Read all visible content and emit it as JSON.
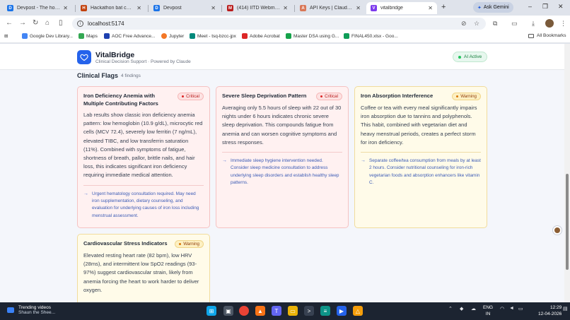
{
  "browser": {
    "tabs": [
      {
        "label": "Devpost - The home fo",
        "favicon": "D",
        "color": "#1a73e8"
      },
      {
        "label": "Hackathon bat challeng",
        "favicon": "H",
        "color": "#c2410c"
      },
      {
        "label": "Devpost",
        "favicon": "D",
        "color": "#1a73e8"
      },
      {
        "label": "(414) IITD Webmail :: In",
        "favicon": "M",
        "color": "#b91c1c"
      },
      {
        "label": "API Keys | Claude Platfo",
        "favicon": "A",
        "color": "#d97757"
      },
      {
        "label": "vitalbridge",
        "favicon": "V",
        "color": "#7c3aed"
      }
    ],
    "new_tab": "+",
    "gemini": "Ask Gemini",
    "window_controls": [
      "–",
      "❐",
      "✕"
    ],
    "address": "localhost:5174",
    "bookmarks": [
      {
        "label": "Google Dev Library...",
        "color": "#4285f4"
      },
      {
        "label": "Maps",
        "color": "#34a853"
      },
      {
        "label": "AOC Free Advance...",
        "color": "#1e40af"
      },
      {
        "label": "Jupyter",
        "color": "#f37726"
      },
      {
        "label": "Meet - tsq-bzcc-jpx",
        "color": "#00897b"
      },
      {
        "label": "Adobe Acrobat",
        "color": "#dc2626"
      },
      {
        "label": "Master DSA using G...",
        "color": "#16a34a"
      },
      {
        "label": "FINAL450.xlsx - Goo...",
        "color": "#0f9d58"
      }
    ],
    "all_bookmarks": "All Bookmarks"
  },
  "app": {
    "brand": "VitalBridge",
    "subtitle": "Clinical Decision Support · Powered by Claude",
    "status": "AI Active"
  },
  "flags": {
    "title": "Clinical Flags",
    "count": "4 findings",
    "cards": [
      {
        "title": "Iron Deficiency Anemia with Multiple Contributing Factors",
        "severity": "Critical",
        "body": "Lab results show classic iron deficiency anemia pattern: low hemoglobin (10.9 g/dL), microcytic red cells (MCV 72.4), severely low ferritin (7 ng/mL), elevated TIBC, and low transferrin saturation (11%). Combined with symptoms of fatigue, shortness of breath, pallor, brittle nails, and hair loss, this indicates significant iron deficiency requiring immediate medical attention.",
        "recommendation": "Urgent hematology consultation required. May need iron supplementation, dietary counseling, and evaluation for underlying causes of iron loss including menstrual assessment."
      },
      {
        "title": "Severe Sleep Deprivation Pattern",
        "severity": "Critical",
        "body": "Averaging only 5.5 hours of sleep with 22 out of 30 nights under 6 hours indicates chronic severe sleep deprivation. This compounds fatigue from anemia and can worsen cognitive symptoms and stress responses.",
        "recommendation": "Immediate sleep hygiene intervention needed. Consider sleep medicine consultation to address underlying sleep disorders and establish healthy sleep patterns."
      },
      {
        "title": "Iron Absorption Interference",
        "severity": "Warning",
        "body": "Coffee or tea with every meal significantly impairs iron absorption due to tannins and polyphenols. This habit, combined with vegetarian diet and heavy menstrual periods, creates a perfect storm for iron deficiency.",
        "recommendation": "Separate coffee/tea consumption from meals by at least 2 hours. Consider nutritional counseling for iron-rich vegetarian foods and absorption enhancers like vitamin C."
      },
      {
        "title": "Cardiovascular Stress Indicators",
        "severity": "Warning",
        "body": "Elevated resting heart rate (82 bpm), low HRV (28ms), and intermittent low SpO2 readings (93-97%) suggest cardiovascular strain, likely from anemia forcing the heart to work harder to deliver oxygen.",
        "recommendation": ""
      }
    ]
  },
  "taskbar": {
    "news_title": "Trending videos",
    "news_sub": "Shaun the Shee...",
    "lang_1": "ENG",
    "lang_2": "IN",
    "time": "12:29",
    "date": "12-04-2026"
  }
}
